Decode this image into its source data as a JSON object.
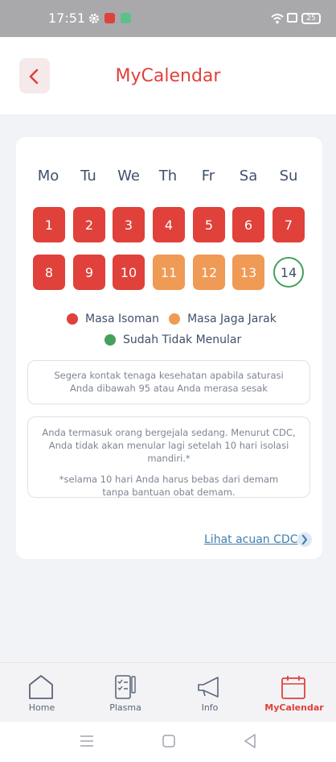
{
  "status_bar": {
    "time": "17:51",
    "battery": "25"
  },
  "header": {
    "title": "MyCalendar"
  },
  "calendar": {
    "weekdays": [
      "Mo",
      "Tu",
      "We",
      "Th",
      "Fr",
      "Sa",
      "Su"
    ],
    "days": [
      "1",
      "2",
      "3",
      "4",
      "5",
      "6",
      "7",
      "8",
      "9",
      "10",
      "11",
      "12",
      "13",
      "14"
    ],
    "colors": {
      "isoman": "#e0413b",
      "jaga_jarak": "#ef9a55",
      "tidak_menular": "#43a15e"
    }
  },
  "legend": {
    "isoman": "Masa Isoman",
    "jaga_jarak": "Masa Jaga Jarak",
    "tidak_menular": "Sudah Tidak Menular"
  },
  "notices": {
    "warning": "Segera kontak tenaga kesehatan apabila saturasi Anda dibawah 95 atau Anda merasa sesak",
    "info_main": "Anda termasuk orang bergejala sedang. Menurut CDC, Anda tidak akan menular lagi setelah 10 hari isolasi mandiri.*",
    "info_note": "*selama 10 hari Anda harus bebas dari demam tanpa bantuan obat demam."
  },
  "cdc_link": "Lihat acuan CDC",
  "bottom_nav": {
    "home": "Home",
    "plasma": "Plasma",
    "info": "Info",
    "mycalendar": "MyCalendar"
  }
}
